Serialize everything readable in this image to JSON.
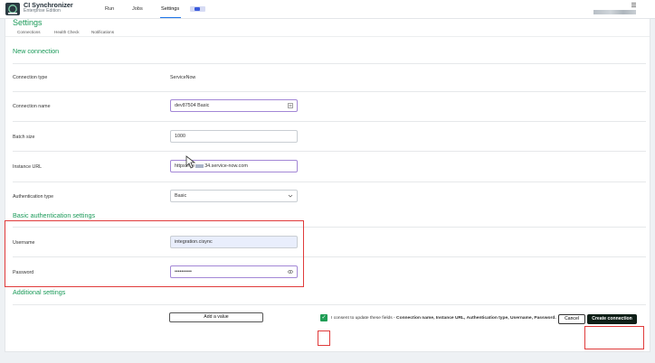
{
  "app": {
    "title": "CI Synchronizer",
    "edition": "Enterprise Edition"
  },
  "nav": {
    "run": "Run",
    "jobs": "Jobs",
    "settings": "Settings"
  },
  "page": {
    "title": "Settings",
    "tabs": [
      "Connections",
      "Health Check",
      "Notifications"
    ],
    "new_connection_heading": "New connection",
    "basic_auth_heading": "Basic authentication settings",
    "additional_heading": "Additional settings"
  },
  "form": {
    "connection_type": {
      "label": "Connection type",
      "value": "ServiceNow"
    },
    "connection_name": {
      "label": "Connection name",
      "value": "dev87504 Basic"
    },
    "batch_size": {
      "label": "Batch size",
      "value": "1000"
    },
    "instance_url": {
      "label": "Instance URL",
      "prefix": "https://de",
      "suffix": "34.service-now.com"
    },
    "auth_type": {
      "label": "Authentication type",
      "value": "Basic"
    },
    "username": {
      "label": "Username",
      "value": "integration.cisync"
    },
    "password": {
      "label": "Password",
      "value": "••••••••••"
    }
  },
  "buttons": {
    "add_value": "Add a value",
    "cancel": "Cancel",
    "create": "Create connection"
  },
  "consent": {
    "checked": true,
    "text": "I consent to update these fields - ",
    "fields": "Connection name, Instance URL, Authentication type, Username, Password."
  },
  "icons": {
    "logo": "ci-synchronizer-logo-icon",
    "field_action": "contact-card-icon",
    "password_reveal": "eye-icon",
    "dropdown": "chevron-down-icon",
    "check": "checkmark-icon",
    "menu": "hamburger-menu-icon"
  },
  "colors": {
    "accent_green": "#1b9a59",
    "primary_dark": "#0f1f17",
    "highlight_red": "#e03b3b",
    "focus_purple": "#a387d6"
  }
}
